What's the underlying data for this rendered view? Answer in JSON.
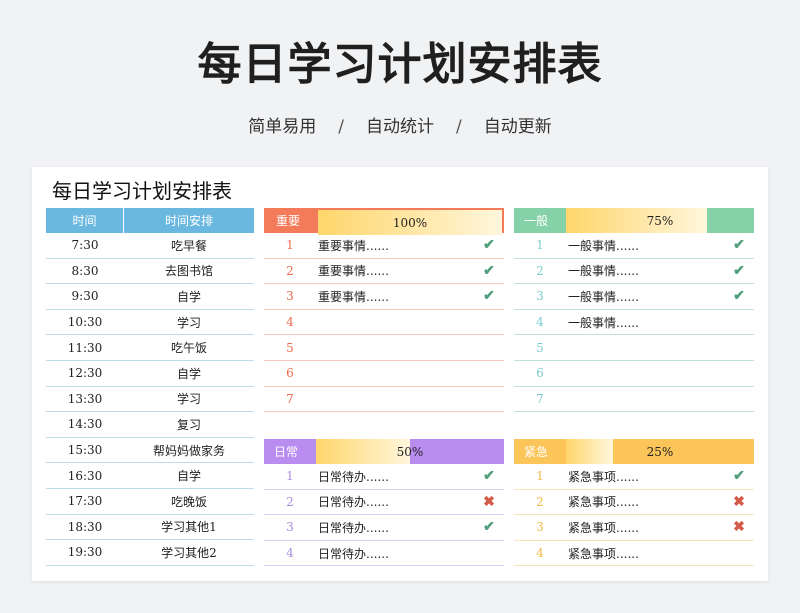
{
  "header": {
    "title": "每日学习计划安排表",
    "subtitle_parts": [
      "简单易用",
      "自动统计",
      "自动更新"
    ],
    "separator": "/"
  },
  "card": {
    "title": "每日学习计划安排表"
  },
  "schedule": {
    "col_time": "时间",
    "col_plan": "时间安排",
    "header_color": "#6ab8e0",
    "rows": [
      {
        "time": "7:30",
        "plan": "吃早餐"
      },
      {
        "time": "8:30",
        "plan": "去图书馆"
      },
      {
        "time": "9:30",
        "plan": "自学"
      },
      {
        "time": "10:30",
        "plan": "学习"
      },
      {
        "time": "11:30",
        "plan": "吃午饭"
      },
      {
        "time": "12:30",
        "plan": "自学"
      },
      {
        "time": "13:30",
        "plan": "学习"
      },
      {
        "time": "14:30",
        "plan": "复习"
      },
      {
        "time": "15:30",
        "plan": "帮妈妈做家务"
      },
      {
        "time": "16:30",
        "plan": "自学"
      },
      {
        "time": "17:30",
        "plan": "吃晚饭"
      },
      {
        "time": "18:30",
        "plan": "学习其他1"
      },
      {
        "time": "19:30",
        "plan": "学习其他2"
      }
    ]
  },
  "panels": {
    "important": {
      "label": "重要",
      "percent_text": "100%",
      "progress": 1.0,
      "label_color": "#f37b5a",
      "fill_color": "#ffd66b",
      "line_color": "#f6c9b8",
      "num_color": "#ef6a4d",
      "rows": [
        {
          "num": "1",
          "task": "重要事情......",
          "mark": "✔",
          "status": "check"
        },
        {
          "num": "2",
          "task": "重要事情......",
          "mark": "✔",
          "status": "check"
        },
        {
          "num": "3",
          "task": "重要事情......",
          "mark": "✔",
          "status": "check"
        },
        {
          "num": "4",
          "task": "",
          "mark": "",
          "status": ""
        },
        {
          "num": "5",
          "task": "",
          "mark": "",
          "status": ""
        },
        {
          "num": "6",
          "task": "",
          "mark": "",
          "status": ""
        },
        {
          "num": "7",
          "task": "",
          "mark": "",
          "status": ""
        }
      ]
    },
    "general": {
      "label": "一般",
      "percent_text": "75%",
      "progress": 0.75,
      "label_color": "#85d1a8",
      "fill_color": "#ffd66b",
      "line_color": "#bfe5d0",
      "num_color": "#7ccdd0",
      "rows": [
        {
          "num": "1",
          "task": "一般事情......",
          "mark": "✔",
          "status": "check"
        },
        {
          "num": "2",
          "task": "一般事情......",
          "mark": "✔",
          "status": "check"
        },
        {
          "num": "3",
          "task": "一般事情......",
          "mark": "✔",
          "status": "check"
        },
        {
          "num": "4",
          "task": "一般事情......",
          "mark": "",
          "status": ""
        },
        {
          "num": "5",
          "task": "",
          "mark": "",
          "status": ""
        },
        {
          "num": "6",
          "task": "",
          "mark": "",
          "status": ""
        },
        {
          "num": "7",
          "task": "",
          "mark": "",
          "status": ""
        }
      ]
    },
    "daily": {
      "label": "日常",
      "percent_text": "50%",
      "progress": 0.5,
      "label_color": "#b98cf0",
      "fill_color": "#ffd66b",
      "line_color": "#ddcdf5",
      "num_color": "#a98fe0",
      "rows": [
        {
          "num": "1",
          "task": "日常待办......",
          "mark": "✔",
          "status": "check"
        },
        {
          "num": "2",
          "task": "日常待办......",
          "mark": "✖",
          "status": "cross"
        },
        {
          "num": "3",
          "task": "日常待办......",
          "mark": "✔",
          "status": "check"
        },
        {
          "num": "4",
          "task": "日常待办......",
          "mark": "",
          "status": ""
        }
      ]
    },
    "urgent": {
      "label": "紧急",
      "percent_text": "25%",
      "progress": 0.25,
      "label_color": "#fbc55a",
      "fill_color": "#ffd66b",
      "line_color": "#f8e3b8",
      "num_color": "#f3b949",
      "rows": [
        {
          "num": "1",
          "task": "紧急事项......",
          "mark": "✔",
          "status": "check"
        },
        {
          "num": "2",
          "task": "紧急事项......",
          "mark": "✖",
          "status": "cross"
        },
        {
          "num": "3",
          "task": "紧急事项......",
          "mark": "✖",
          "status": "cross"
        },
        {
          "num": "4",
          "task": "紧急事项......",
          "mark": "",
          "status": ""
        }
      ]
    }
  }
}
